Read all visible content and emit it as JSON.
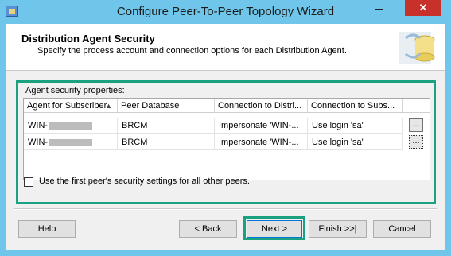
{
  "window": {
    "title": "Configure Peer-To-Peer Topology Wizard",
    "minimize_icon": "minimize-icon",
    "close_label": "✕"
  },
  "header": {
    "title": "Distribution Agent Security",
    "subtitle": "Specify the process account and connection options for each Distribution Agent."
  },
  "properties": {
    "label": "Agent security properties:",
    "columns": [
      "Agent for Subscriber",
      "Peer Database",
      "Connection to Distri...",
      "Connection to Subs..."
    ],
    "rows": [
      {
        "agent": "WIN-",
        "database": "BRCM",
        "conn_distributor": "Impersonate 'WIN-...",
        "conn_subscriber": "Use login 'sa'",
        "button": "..."
      },
      {
        "agent": "WIN-",
        "database": "BRCM",
        "conn_distributor": "Impersonate 'WIN-...",
        "conn_subscriber": "Use login 'sa'",
        "button": "..."
      }
    ]
  },
  "checkbox": {
    "label": "Use the first peer's security settings for all other peers.",
    "checked": false
  },
  "buttons": {
    "help": "Help",
    "back": "< Back",
    "next": "Next >",
    "finish": "Finish >>|",
    "cancel": "Cancel"
  },
  "colors": {
    "titlebar": "#6fc6ea",
    "highlight": "#1aa180",
    "close": "#c7302b"
  }
}
